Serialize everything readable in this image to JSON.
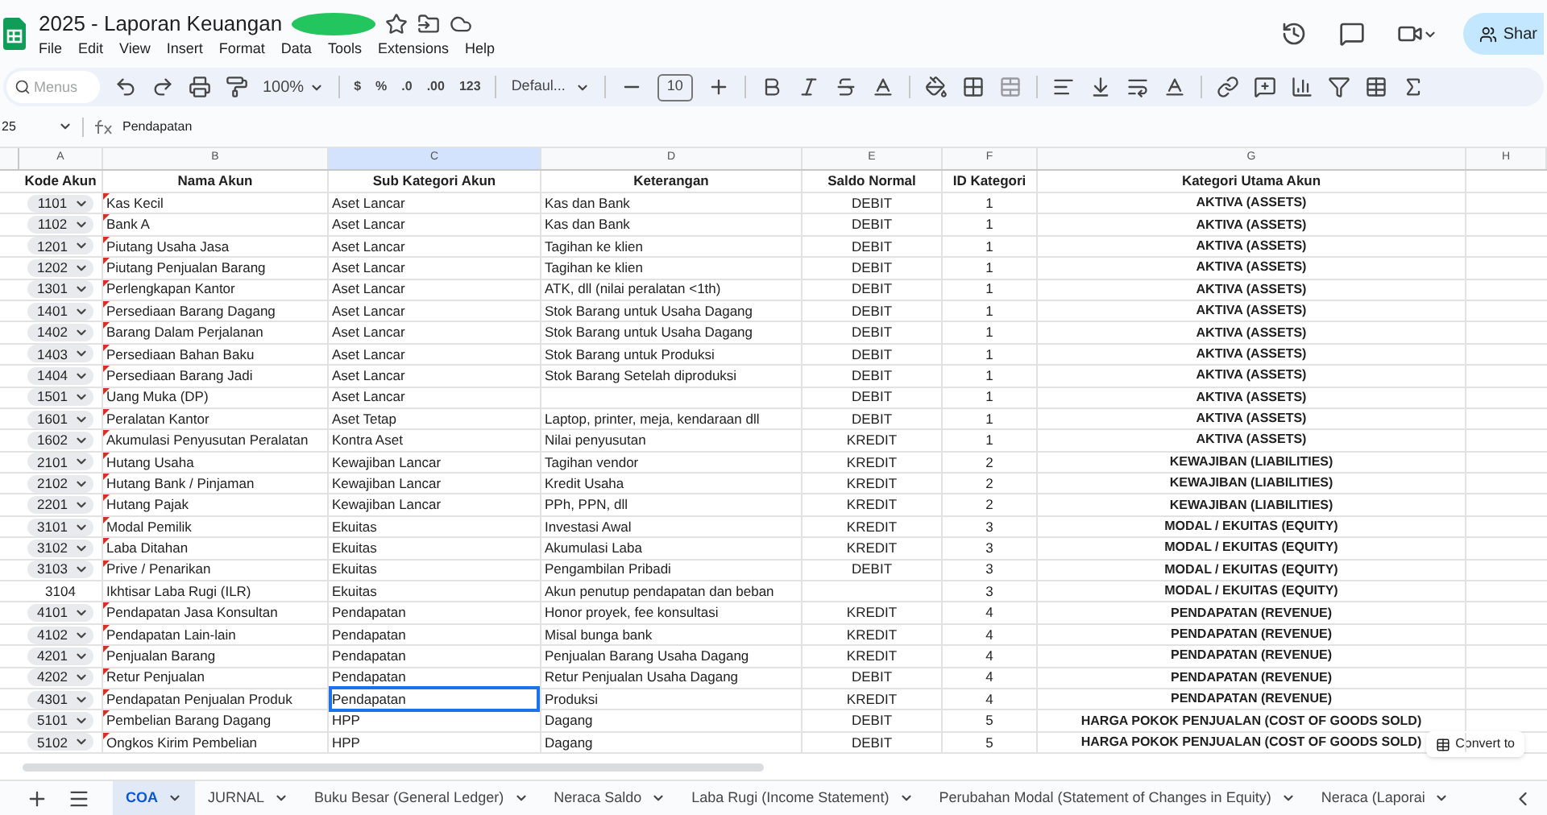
{
  "doc": {
    "title": "2025 - Laporan Keuangan",
    "menus": [
      "File",
      "Edit",
      "View",
      "Insert",
      "Format",
      "Data",
      "Tools",
      "Extensions",
      "Help"
    ],
    "share": "Shar"
  },
  "toolbar": {
    "search_placeholder": "Menus",
    "zoom": "100%",
    "number_formats": [
      "$",
      "%",
      ".0",
      ".00",
      "123"
    ],
    "font": "Defaul...",
    "font_size": "10"
  },
  "formula_bar": {
    "name_box": "25",
    "value": "Pendapatan"
  },
  "columns": [
    {
      "letter": "A",
      "selected": false
    },
    {
      "letter": "B",
      "selected": false
    },
    {
      "letter": "C",
      "selected": true
    },
    {
      "letter": "D",
      "selected": false
    },
    {
      "letter": "E",
      "selected": false
    },
    {
      "letter": "F",
      "selected": false
    },
    {
      "letter": "G",
      "selected": false
    },
    {
      "letter": "H",
      "selected": false
    }
  ],
  "headers": [
    "Kode Akun",
    "Nama Akun",
    "Sub Kategori Akun",
    "Keterangan",
    "Saldo Normal",
    "ID Kategori",
    "Kategori Utama Akun"
  ],
  "rows": [
    {
      "cells": [
        "1101",
        "Kas Kecil",
        "Aset Lancar",
        "Kas dan Bank",
        "DEBIT",
        "1",
        "AKTIVA (ASSETS)"
      ],
      "dropdown": true,
      "note": true,
      "active": false
    },
    {
      "cells": [
        "1102",
        "Bank A",
        "Aset Lancar",
        "Kas dan Bank",
        "DEBIT",
        "1",
        "AKTIVA (ASSETS)"
      ],
      "dropdown": true,
      "note": true,
      "active": false
    },
    {
      "cells": [
        "1201",
        "Piutang Usaha Jasa",
        "Aset Lancar",
        "Tagihan ke klien",
        "DEBIT",
        "1",
        "AKTIVA (ASSETS)"
      ],
      "dropdown": true,
      "note": true,
      "active": false
    },
    {
      "cells": [
        "1202",
        "Piutang Penjualan Barang",
        "Aset Lancar",
        "Tagihan ke klien",
        "DEBIT",
        "1",
        "AKTIVA (ASSETS)"
      ],
      "dropdown": true,
      "note": true,
      "active": false
    },
    {
      "cells": [
        "1301",
        "Perlengkapan Kantor",
        "Aset Lancar",
        "ATK, dll (nilai peralatan <1th)",
        "DEBIT",
        "1",
        "AKTIVA (ASSETS)"
      ],
      "dropdown": true,
      "note": true,
      "active": false
    },
    {
      "cells": [
        "1401",
        "Persediaan Barang Dagang",
        "Aset Lancar",
        "Stok Barang untuk Usaha Dagang",
        "DEBIT",
        "1",
        "AKTIVA (ASSETS)"
      ],
      "dropdown": true,
      "note": true,
      "active": false
    },
    {
      "cells": [
        "1402",
        "Barang Dalam Perjalanan",
        "Aset Lancar",
        "Stok Barang untuk Usaha Dagang",
        "DEBIT",
        "1",
        "AKTIVA (ASSETS)"
      ],
      "dropdown": true,
      "note": true,
      "active": false
    },
    {
      "cells": [
        "1403",
        "Persediaan Bahan Baku",
        "Aset Lancar",
        "Stok Barang untuk Produksi",
        "DEBIT",
        "1",
        "AKTIVA (ASSETS)"
      ],
      "dropdown": true,
      "note": true,
      "active": false
    },
    {
      "cells": [
        "1404",
        "Persediaan Barang Jadi",
        "Aset Lancar",
        "Stok Barang Setelah diproduksi",
        "DEBIT",
        "1",
        "AKTIVA (ASSETS)"
      ],
      "dropdown": true,
      "note": true,
      "active": false
    },
    {
      "cells": [
        "1501",
        "Uang Muka (DP)",
        "Aset Lancar",
        "",
        "DEBIT",
        "1",
        "AKTIVA (ASSETS)"
      ],
      "dropdown": true,
      "note": true,
      "active": false
    },
    {
      "cells": [
        "1601",
        "Peralatan Kantor",
        "Aset Tetap",
        "Laptop, printer, meja, kendaraan dll",
        "DEBIT",
        "1",
        "AKTIVA (ASSETS)"
      ],
      "dropdown": true,
      "note": true,
      "active": false
    },
    {
      "cells": [
        "1602",
        "Akumulasi Penyusutan Peralatan",
        "Kontra Aset",
        "Nilai penyusutan",
        "KREDIT",
        "1",
        "AKTIVA (ASSETS)"
      ],
      "dropdown": true,
      "note": true,
      "active": false
    },
    {
      "cells": [
        "2101",
        "Hutang Usaha",
        "Kewajiban Lancar",
        "Tagihan vendor",
        "KREDIT",
        "2",
        "KEWAJIBAN (LIABILITIES)"
      ],
      "dropdown": true,
      "note": true,
      "active": false
    },
    {
      "cells": [
        "2102",
        "Hutang Bank / Pinjaman",
        "Kewajiban Lancar",
        "Kredit Usaha",
        "KREDIT",
        "2",
        "KEWAJIBAN (LIABILITIES)"
      ],
      "dropdown": true,
      "note": true,
      "active": false
    },
    {
      "cells": [
        "2201",
        "Hutang Pajak",
        "Kewajiban Lancar",
        "PPh, PPN, dll",
        "KREDIT",
        "2",
        "KEWAJIBAN (LIABILITIES)"
      ],
      "dropdown": true,
      "note": true,
      "active": false
    },
    {
      "cells": [
        "3101",
        "Modal Pemilik",
        "Ekuitas",
        "Investasi Awal",
        "KREDIT",
        "3",
        "MODAL / EKUITAS (EQUITY)"
      ],
      "dropdown": true,
      "note": true,
      "active": false
    },
    {
      "cells": [
        "3102",
        "Laba Ditahan",
        "Ekuitas",
        "Akumulasi Laba",
        "KREDIT",
        "3",
        "MODAL / EKUITAS (EQUITY)"
      ],
      "dropdown": true,
      "note": true,
      "active": false
    },
    {
      "cells": [
        "3103",
        "Prive / Penarikan",
        "Ekuitas",
        "Pengambilan Pribadi",
        "DEBIT",
        "3",
        "MODAL / EKUITAS (EQUITY)"
      ],
      "dropdown": true,
      "note": true,
      "active": false
    },
    {
      "cells": [
        "3104",
        "Ikhtisar Laba Rugi (ILR)",
        "Ekuitas",
        "Akun penutup pendapatan dan beban",
        "",
        "3",
        "MODAL / EKUITAS (EQUITY)"
      ],
      "dropdown": false,
      "note": false,
      "active": false
    },
    {
      "cells": [
        "4101",
        "Pendapatan Jasa Konsultan",
        "Pendapatan",
        "Honor proyek, fee konsultasi",
        "KREDIT",
        "4",
        "PENDAPATAN (REVENUE)"
      ],
      "dropdown": true,
      "note": true,
      "active": false
    },
    {
      "cells": [
        "4102",
        "Pendapatan Lain-lain",
        "Pendapatan",
        "Misal bunga bank",
        "KREDIT",
        "4",
        "PENDAPATAN (REVENUE)"
      ],
      "dropdown": true,
      "note": true,
      "active": false
    },
    {
      "cells": [
        "4201",
        "Penjualan Barang",
        "Pendapatan",
        "Penjualan Barang Usaha Dagang",
        "KREDIT",
        "4",
        "PENDAPATAN (REVENUE)"
      ],
      "dropdown": true,
      "note": true,
      "active": false
    },
    {
      "cells": [
        "4202",
        "Retur Penjualan",
        "Pendapatan",
        "Retur Penjualan Usaha Dagang",
        "DEBIT",
        "4",
        "PENDAPATAN (REVENUE)"
      ],
      "dropdown": true,
      "note": true,
      "active": false
    },
    {
      "cells": [
        "4301",
        "Pendapatan Penjualan Produk",
        "Pendapatan",
        "Produksi",
        "KREDIT",
        "4",
        "PENDAPATAN (REVENUE)"
      ],
      "dropdown": true,
      "note": true,
      "active": true
    },
    {
      "cells": [
        "5101",
        "Pembelian Barang Dagang",
        "HPP",
        "Dagang",
        "DEBIT",
        "5",
        "HARGA POKOK PENJUALAN (COST OF GOODS SOLD)"
      ],
      "dropdown": true,
      "note": true,
      "active": false
    },
    {
      "cells": [
        "5102",
        "Ongkos Kirim Pembelian",
        "HPP",
        "Dagang",
        "DEBIT",
        "5",
        "HARGA POKOK PENJUALAN (COST OF GOODS SOLD)"
      ],
      "dropdown": true,
      "note": true,
      "active": false
    }
  ],
  "convert_chip": "Convert to",
  "sheet_tabs": [
    {
      "label": "COA",
      "selected": true
    },
    {
      "label": "JURNAL",
      "selected": false
    },
    {
      "label": "Buku Besar (General Ledger)",
      "selected": false
    },
    {
      "label": "Neraca Saldo",
      "selected": false
    },
    {
      "label": "Laba Rugi (Income Statement)",
      "selected": false
    },
    {
      "label": "Perubahan Modal (Statement of Changes in Equity)",
      "selected": false
    },
    {
      "label": "Neraca (Laporai",
      "selected": false
    }
  ]
}
